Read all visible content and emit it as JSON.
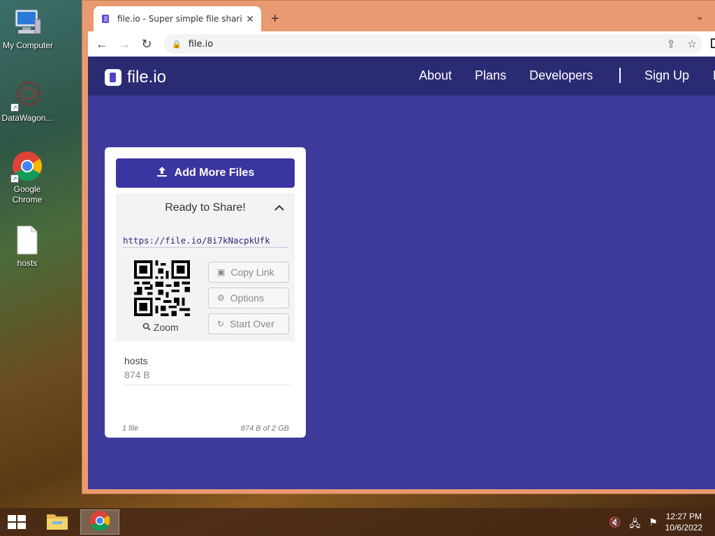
{
  "desktop": {
    "icons": [
      {
        "label": "My Computer"
      },
      {
        "label": "DataWagon..."
      },
      {
        "label": "Google\nChrome"
      },
      {
        "label": "hosts"
      }
    ]
  },
  "browser": {
    "tab_title": "file.io - Super simple file sharing",
    "new_tab_label": "+",
    "url": "file.io"
  },
  "site": {
    "brand": "file.io",
    "nav": {
      "about": "About",
      "plans": "Plans",
      "developers": "Developers",
      "signup": "Sign Up",
      "more": "L"
    },
    "card": {
      "add_button": "Add More Files",
      "share_heading": "Ready to Share!",
      "link": "https://file.io/8i7kNacpkUfk",
      "zoom_label": "Zoom",
      "copy_link": "Copy Link",
      "options": "Options",
      "start_over": "Start Over",
      "file_name": "hosts",
      "file_size": "874 B",
      "file_count": "1 file",
      "usage": "874 B of 2 GB"
    },
    "colors": {
      "page_bg": "#3d3a9c",
      "nav_bg": "#2b2b74",
      "button": "#3a35a0"
    }
  },
  "taskbar": {
    "clock_time": "12:27 PM",
    "clock_date": "10/6/2022",
    "items": [
      "file-explorer",
      "google-chrome"
    ]
  }
}
